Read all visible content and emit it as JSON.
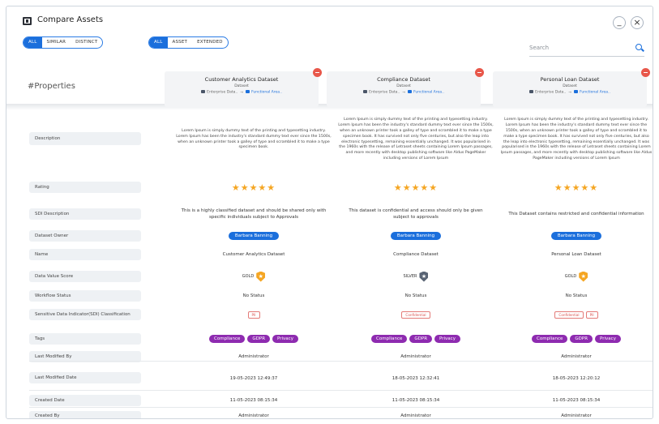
{
  "window": {
    "title": "Compare Assets",
    "minimize": "_",
    "close": "×"
  },
  "filters": {
    "similarity": [
      {
        "label": "ALL",
        "active": true
      },
      {
        "label": "SIMILAR",
        "active": false
      },
      {
        "label": "DISTINCT",
        "active": false
      }
    ],
    "type": [
      {
        "label": "ALL",
        "active": true
      },
      {
        "label": "ASSET",
        "active": false
      },
      {
        "label": "EXTENDED",
        "active": false
      }
    ]
  },
  "search": {
    "placeholder": "Search"
  },
  "header": {
    "props_title": "#Properties"
  },
  "assets": [
    {
      "name": "Customer Analytics Dataset",
      "type": "Dataset",
      "bc_root": "Enterprise Data..",
      "bc_leaf": "Functional Area.."
    },
    {
      "name": "Compliance Dataset",
      "type": "Dataset",
      "bc_root": "Enterprise Data..",
      "bc_leaf": "Functional Area.."
    },
    {
      "name": "Personal Loan Dataset",
      "type": "Dataset",
      "bc_root": "Enterprise Data..",
      "bc_leaf": "Functional Area.."
    }
  ],
  "rows": {
    "description": {
      "label": "Description",
      "values": [
        "Lorem Ipsum is simply dummy text of the printing and typesetting industry. Lorem Ipsum has been the industry's standard dummy text ever since the 1500s, when an unknown printer took a galley of type and scrambled it to make a type specimen book.",
        "Lorem Ipsum is simply dummy text of the printing and typesetting industry. Lorem Ipsum has been the industry's standard dummy text ever since the 1500s, when an unknown printer took a galley of type and scrambled it to make a type specimen book. It has survived not only five centuries, but also the leap into electronic typesetting, remaining essentially unchanged. It was popularised in the 1960s with the release of Letraset sheets containing Lorem Ipsum passages, and more recently with desktop publishing software like Aldus PageMaker including versions of Lorem Ipsum",
        "Lorem Ipsum is simply dummy text of the printing and typesetting industry. Lorem Ipsum has been the industry's standard dummy text ever since the 1500s, when an unknown printer took a galley of type and scrambled it to make a type specimen book. It has survived not only five centuries, but also the leap into electronic typesetting, remaining essentially unchanged. It was popularised in the 1960s with the release of Letraset sheets containing Lorem Ipsum passages, and more recently with desktop publishing software like Aldus PageMaker including versions of Lorem Ipsum"
      ]
    },
    "rating": {
      "label": "Rating",
      "values": [
        5,
        5,
        5
      ],
      "stars": [
        "★★★★★",
        "★★★★★",
        "★★★★★"
      ]
    },
    "sdi_description": {
      "label": "SDI Description",
      "values": [
        "This is a highly classified dataset and should be shared only with specific individuals subject to Approvals",
        "This dataset is confidential and access should only be given subject to approvals",
        "This Dataset contains restricted and confidential information"
      ]
    },
    "owner": {
      "label": "Dataset Owner",
      "values": [
        "Barbara Banning",
        "Barbara Banning",
        "Barbara Banning"
      ]
    },
    "name": {
      "label": "Name",
      "values": [
        "Customer Analytics Dataset",
        "Compliance Dataset",
        "Personal Loan Dataset"
      ]
    },
    "dvs": {
      "label": "Data Value Score",
      "values": [
        {
          "word": "GOLD",
          "icon": "★",
          "color": "#f5a623"
        },
        {
          "word": "SILVER",
          "icon": "★",
          "color": "#596474"
        },
        {
          "word": "GOLD",
          "icon": "★",
          "color": "#f5a623"
        }
      ]
    },
    "workflow": {
      "label": "Workflow Status",
      "values": [
        "No Status",
        "No Status",
        "No Status"
      ]
    },
    "sdi_class": {
      "label": "Sensitive Data Indicator(SDI) Classification",
      "values": [
        [
          "PII"
        ],
        [
          "Confidential"
        ],
        [
          "Confidential",
          "PII"
        ]
      ]
    },
    "tags": {
      "label": "Tags",
      "values": [
        [
          "Compliance",
          "GDPR",
          "Privacy"
        ],
        [
          "Compliance",
          "GDPR",
          "Privacy"
        ],
        [
          "Compliance",
          "GDPR",
          "Privacy"
        ]
      ]
    },
    "modified_by": {
      "label": "Last Modified By",
      "values": [
        "Administrator",
        "Administrator",
        "Administrator"
      ]
    },
    "modified_date": {
      "label": "Last Modified Date",
      "values": [
        "19-05-2023 12:49:37",
        "18-05-2023 12:32:41",
        "18-05-2023 12:20:12"
      ]
    },
    "created_date": {
      "label": "Created Date",
      "values": [
        "11-05-2023 08:15:34",
        "11-05-2023 08:15:34",
        "11-05-2023 08:15:34"
      ]
    },
    "created_by": {
      "label": "Created By",
      "values": [
        "Administrator",
        "Administrator",
        "Administrator"
      ]
    }
  },
  "colors": {
    "accent": "#1b6fdc",
    "tag": "#8e2bb0",
    "remove": "#e8574a",
    "star": "#f5a623"
  }
}
